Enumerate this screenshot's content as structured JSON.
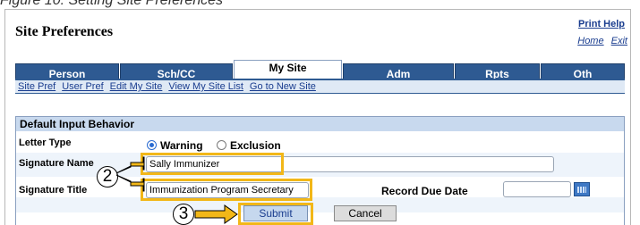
{
  "caption": "Figure 10: Setting Site Preferences",
  "header": {
    "title": "Site Preferences",
    "print_help": "Print Help",
    "links": [
      "Home",
      "Exit"
    ]
  },
  "tabs": [
    {
      "label": "Person",
      "active": false
    },
    {
      "label": "Sch/CC",
      "active": false
    },
    {
      "label": "My Site",
      "active": true
    },
    {
      "label": "Adm",
      "active": false
    },
    {
      "label": "Rpts",
      "active": false
    },
    {
      "label": "Oth",
      "active": false
    }
  ],
  "subnav": [
    "Site Pref",
    "User Pref",
    "Edit My Site",
    "View My Site List",
    "Go to New Site"
  ],
  "section": {
    "heading": "Default Input Behavior",
    "letter_type": {
      "label": "Letter Type",
      "options": [
        {
          "label": "Warning",
          "selected": true
        },
        {
          "label": "Exclusion",
          "selected": false
        }
      ]
    },
    "signature_name": {
      "label": "Signature Name",
      "value": "Sally Immunizer"
    },
    "signature_title": {
      "label": "Signature Title",
      "value": "Immunization Program Secretary"
    },
    "record_due_date": {
      "label": "Record Due Date",
      "value": ""
    }
  },
  "buttons": {
    "submit": "Submit",
    "cancel": "Cancel"
  },
  "callouts": {
    "step2": "2",
    "step3": "3"
  },
  "colors": {
    "tab_blue": "#2e5a92",
    "highlight": "#f2b718",
    "link": "#1a3d8f"
  }
}
